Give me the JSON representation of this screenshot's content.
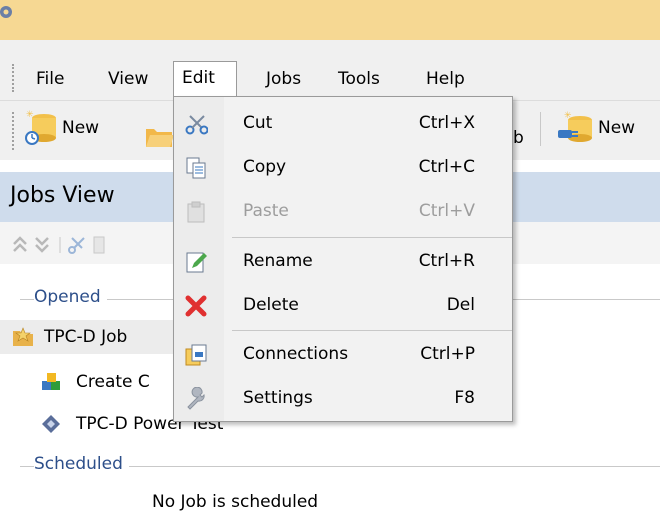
{
  "menubar": {
    "items": [
      {
        "label": "File"
      },
      {
        "label": "View"
      },
      {
        "label": "Edit"
      },
      {
        "label": "Jobs"
      },
      {
        "label": "Tools"
      },
      {
        "label": "Help"
      }
    ]
  },
  "toolbar": {
    "new_job_label": "New",
    "run_job_label_fragment": "b",
    "new_connection_label": "New"
  },
  "jobs_view": {
    "title": "Jobs View",
    "opened_label": "Opened",
    "scheduled_label": "Scheduled",
    "empty_scheduled": "No Job is scheduled",
    "tree": [
      {
        "label": "TPC-D Job",
        "icon": "job-folder-icon"
      },
      {
        "label": "Create C",
        "icon": "create-cubes-icon"
      },
      {
        "label": "TPC-D Power Test",
        "icon": "power-test-icon"
      }
    ]
  },
  "edit_menu": {
    "items": [
      {
        "label": "Cut",
        "shortcut": "Ctrl+X",
        "icon": "scissors-icon",
        "enabled": true
      },
      {
        "label": "Copy",
        "shortcut": "Ctrl+C",
        "icon": "copy-icon",
        "enabled": true
      },
      {
        "label": "Paste",
        "shortcut": "Ctrl+V",
        "icon": "paste-icon",
        "enabled": false
      },
      {
        "label": "Rename",
        "shortcut": "Ctrl+R",
        "icon": "rename-icon",
        "enabled": true
      },
      {
        "label": "Delete",
        "shortcut": "Del",
        "icon": "delete-x-icon",
        "enabled": true
      },
      {
        "label": "Connections",
        "shortcut": "Ctrl+P",
        "icon": "connections-icon",
        "enabled": true
      },
      {
        "label": "Settings",
        "shortcut": "F8",
        "icon": "wrench-icon",
        "enabled": true
      }
    ]
  },
  "colors": {
    "title_bar": "#f6d893",
    "pane_header": "#cfdcec",
    "group_label": "#2d4f8a",
    "delete_red": "#e03030"
  }
}
